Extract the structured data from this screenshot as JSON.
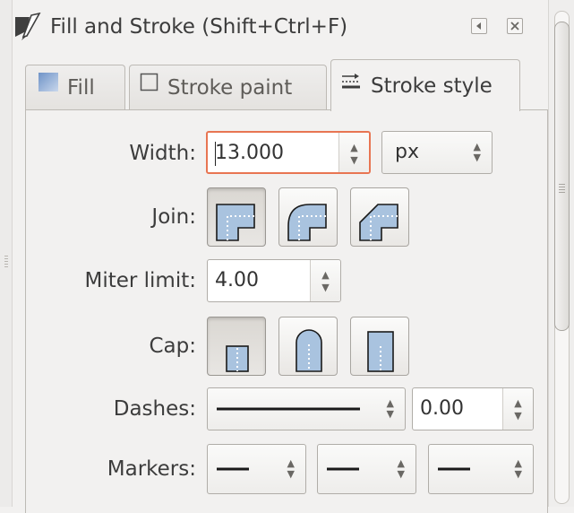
{
  "window": {
    "title": "Fill and Stroke (Shift+Ctrl+F)"
  },
  "tabs": [
    {
      "label": "Fill",
      "icon": "fill-icon"
    },
    {
      "label": "Stroke paint",
      "icon": "stroke-paint-icon"
    },
    {
      "label": "Stroke style",
      "icon": "stroke-style-icon",
      "active": true
    }
  ],
  "stroke_style": {
    "width_label": "Width:",
    "width_value": "13.000",
    "unit_value": "px",
    "join_label": "Join:",
    "join_options": [
      "miter-join",
      "round-join",
      "bevel-join"
    ],
    "join_selected": "miter-join",
    "miter_label": "Miter limit:",
    "miter_value": "4.00",
    "cap_label": "Cap:",
    "cap_options": [
      "butt-cap",
      "round-cap",
      "square-cap"
    ],
    "cap_selected": "butt-cap",
    "dashes_label": "Dashes:",
    "dash_pattern": "solid",
    "dash_offset": "0.00",
    "markers_label": "Markers:",
    "markers": [
      "start-marker",
      "mid-marker",
      "end-marker"
    ]
  },
  "colors": {
    "accent_focus": "#e87552",
    "swatch_blue": "#a9c3df"
  }
}
